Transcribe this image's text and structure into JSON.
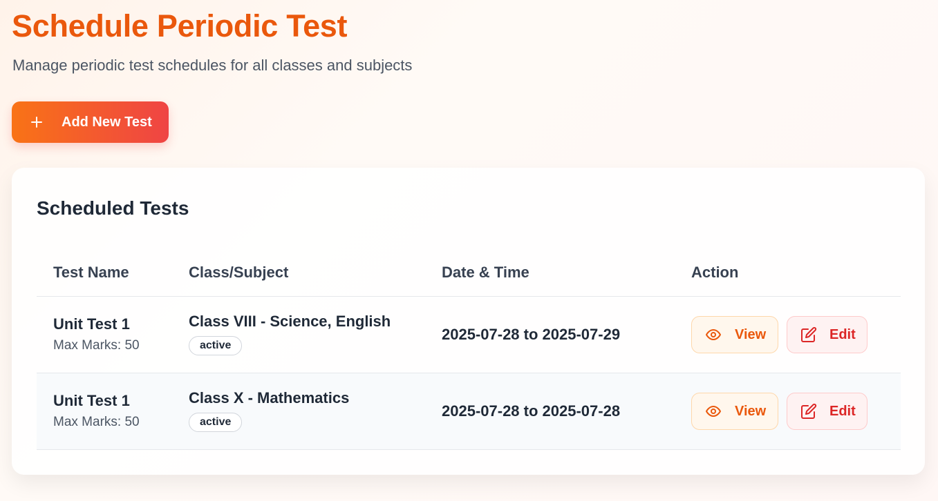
{
  "header": {
    "title": "Schedule Periodic Test",
    "subtitle": "Manage periodic test schedules for all classes and subjects",
    "add_button_label": "Add New Test"
  },
  "scheduled": {
    "title": "Scheduled Tests",
    "columns": [
      "Test Name",
      "Class/Subject",
      "Date & Time",
      "Action"
    ],
    "rows": [
      {
        "test_name": "Unit Test 1",
        "max_marks": "Max Marks: 50",
        "class_subject": "Class VIII - Science, English",
        "status": "active",
        "date_range": "2025-07-28 to 2025-07-29",
        "view_label": "View",
        "edit_label": "Edit"
      },
      {
        "test_name": "Unit Test 1",
        "max_marks": "Max Marks: 50",
        "class_subject": "Class X - Mathematics",
        "status": "active",
        "date_range": "2025-07-28 to 2025-07-28",
        "view_label": "View",
        "edit_label": "Edit"
      }
    ]
  },
  "icons": {
    "add": "plus-icon",
    "view": "eye-icon",
    "edit": "edit-icon"
  },
  "colors": {
    "accent": "#ea580c",
    "gradient_start": "#f97316",
    "gradient_end": "#ef4444",
    "danger": "#dc2626"
  }
}
